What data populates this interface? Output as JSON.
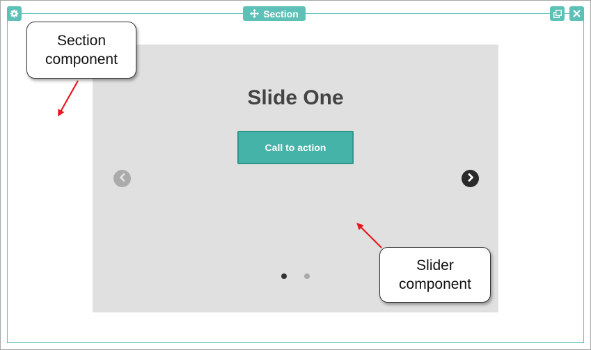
{
  "section_toolbar": {
    "settings_icon": "gear-icon",
    "label": "Section",
    "move_icon": "move-icon",
    "duplicate_icon": "duplicate-icon",
    "close_icon": "close-icon"
  },
  "slider": {
    "slide_title": "Slide One",
    "cta_label": "Call to action",
    "prev_icon": "chevron-left-icon",
    "next_icon": "chevron-right-icon",
    "slide_count": 2,
    "active_slide": 1
  },
  "callouts": {
    "section_lines": [
      "Section",
      "component"
    ],
    "slider_lines": [
      "Slider",
      "component"
    ]
  },
  "colors": {
    "accent": "#5dc1b7",
    "cta": "#45b3a8",
    "slider_bg": "#e0e0e0",
    "annotation_arrow": "#e8191e"
  }
}
